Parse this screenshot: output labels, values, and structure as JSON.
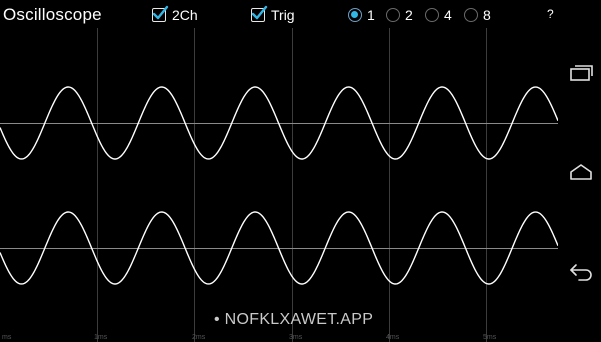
{
  "app": {
    "title": "Oscilloscope"
  },
  "toolbar": {
    "channels_label": "2Ch",
    "channels_checked": true,
    "trigger_label": "Trig",
    "trigger_checked": true,
    "timebase_options": [
      "1",
      "2",
      "4",
      "8"
    ],
    "timebase_selected": "1",
    "help_label": "?"
  },
  "scope": {
    "time_ticks": [
      "ms",
      "1ms",
      "2ms",
      "3ms",
      "4ms",
      "5ms"
    ],
    "channels": [
      {
        "name": "channel-1"
      },
      {
        "name": "channel-2"
      }
    ],
    "waveform": {
      "shape": "sine",
      "cycles_visible": 6
    }
  },
  "watermark": "• NOFKLXAWET.APP",
  "nav": {
    "icons": [
      "recent-apps-icon",
      "home-icon",
      "back-icon"
    ]
  },
  "colors": {
    "background": "#000000",
    "grid": "#3c3c3c",
    "trace": "#ffffff",
    "baseline": "#8a8a8a",
    "radio_accent": "#33b5e5"
  }
}
